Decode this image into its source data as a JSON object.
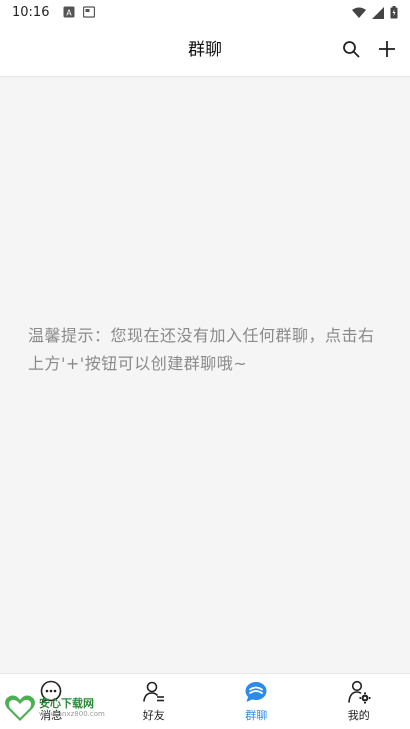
{
  "status_bar": {
    "time": "10:16"
  },
  "app_bar": {
    "title": "群聊"
  },
  "content": {
    "hint": "温馨提示：您现在还没有加入任何群聊，点击右上方'+'按钮可以创建群聊哦~"
  },
  "bottom_nav": {
    "items": [
      {
        "label": "消息",
        "icon": "chat-bubble-icon"
      },
      {
        "label": "好友",
        "icon": "friends-icon"
      },
      {
        "label": "群聊",
        "icon": "group-chat-icon",
        "active": true
      },
      {
        "label": "我的",
        "icon": "profile-settings-icon"
      }
    ]
  },
  "watermark": {
    "title": "安心下载网",
    "sub": "www.anxz800.com"
  },
  "colors": {
    "accent": "#2a8be8",
    "hint_text": "#8a8a8a",
    "background": "#f5f5f5"
  }
}
